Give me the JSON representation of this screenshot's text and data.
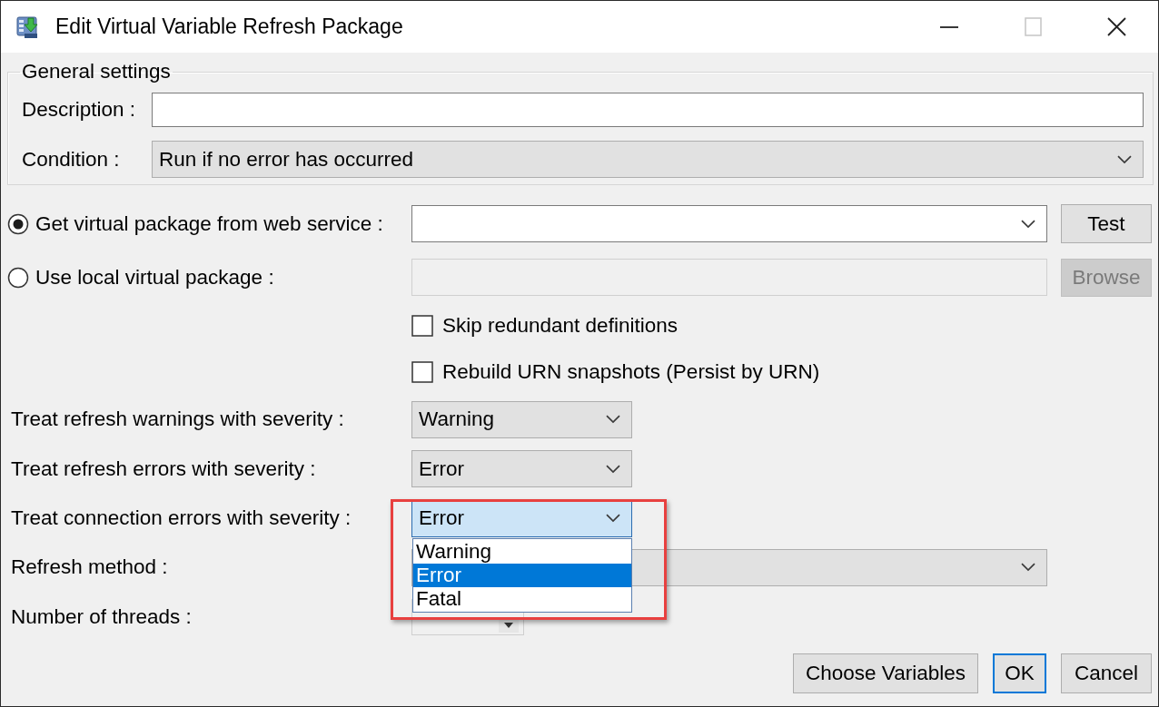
{
  "window": {
    "title": "Edit Virtual Variable Refresh Package",
    "title_buttons": [
      {
        "kind": "minimize",
        "disabled": false
      },
      {
        "kind": "maximize",
        "disabled": true
      },
      {
        "kind": "close",
        "disabled": false
      }
    ]
  },
  "general_settings": {
    "title": "General settings",
    "description": {
      "label": "Description :"
    },
    "condition": {
      "label": "Condition :",
      "value": "Run if no error has occurred"
    }
  },
  "package_source": [
    {
      "label": "Get virtual package from web service :",
      "selected": true,
      "field": {
        "kind": "dropdown",
        "disabled": false
      },
      "button": {
        "label": "Test",
        "disabled": false
      }
    },
    {
      "label": "Use local virtual package :",
      "selected": false,
      "field": {
        "kind": "text",
        "disabled": true
      },
      "button": {
        "label": "Browse",
        "disabled": true
      }
    }
  ],
  "options": [
    {
      "label": "Skip redundant definitions",
      "checked": false
    },
    {
      "label": "Rebuild URN snapshots (Persist by URN)",
      "checked": false
    }
  ],
  "severity_settings": [
    {
      "label": "Treat refresh warnings with severity :",
      "value": "Warning",
      "focused": false,
      "highlighted": false
    },
    {
      "label": "Treat refresh errors with severity :",
      "value": "Error",
      "focused": false,
      "highlighted": false
    },
    {
      "label": "Treat connection errors with severity :",
      "value": "Error",
      "focused": true,
      "highlighted": true,
      "options": [
        {
          "label": "Warning",
          "selected": false
        },
        {
          "label": "Error",
          "selected": true
        },
        {
          "label": "Fatal",
          "selected": false
        }
      ]
    }
  ],
  "refresh_method": {
    "label": "Refresh method :"
  },
  "threads": {
    "label": "Number of threads :"
  },
  "buttons": [
    {
      "label": "Choose Variables",
      "default": false
    },
    {
      "label": "OK",
      "default": true
    },
    {
      "label": "Cancel",
      "default": false
    }
  ]
}
